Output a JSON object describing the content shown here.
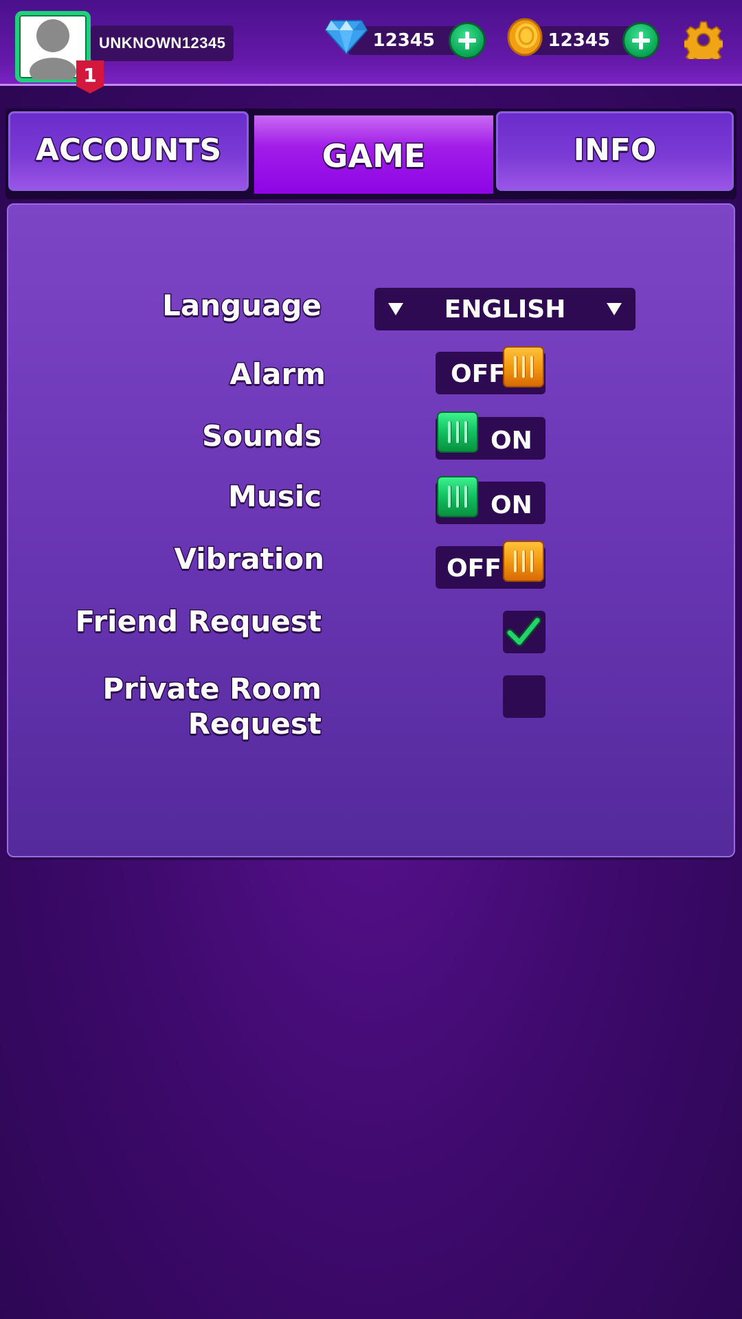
{
  "player": {
    "username": "UNKNOWN12345",
    "level": "1"
  },
  "currency": {
    "gems": "12345",
    "coins": "12345"
  },
  "tabs": [
    {
      "label": "ACCOUNTS",
      "active": false
    },
    {
      "label": "GAME",
      "active": true
    },
    {
      "label": "INFO",
      "active": false
    }
  ],
  "settings": {
    "language": {
      "label": "Language",
      "value": "ENGLISH"
    },
    "alarm": {
      "label": "Alarm",
      "state": "OFF"
    },
    "sounds": {
      "label": "Sounds",
      "state": "ON"
    },
    "music": {
      "label": "Music",
      "state": "ON"
    },
    "vibration": {
      "label": "Vibration",
      "state": "OFF"
    },
    "friend_request": {
      "label": "Friend Request",
      "checked": true
    },
    "private_room_request": {
      "label_line1": "Private Room",
      "label_line2": "Request",
      "checked": false
    }
  },
  "colors": {
    "toggle_on": "#11c061",
    "toggle_off": "#f29a10",
    "active_tab": "#a21ce8",
    "panel": "#6a36b4"
  }
}
